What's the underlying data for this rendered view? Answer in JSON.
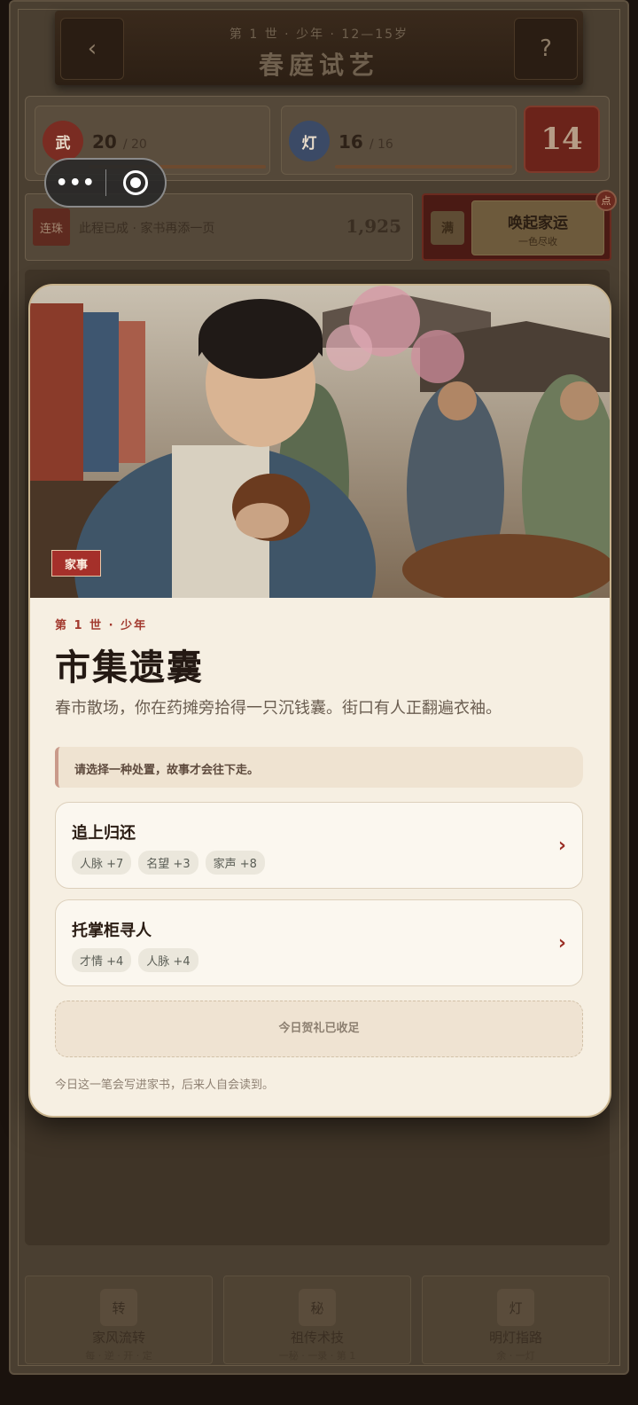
{
  "header": {
    "subtitle": "第 1 世 · 少年 · 12—15岁",
    "title": "春庭试艺",
    "back_label": "‹",
    "help_label": "?"
  },
  "stats": {
    "martial": {
      "icon_label": "武",
      "value": "20",
      "max": "/ 20",
      "fill": 1.0
    },
    "lamp": {
      "icon_label": "灯",
      "value": "16",
      "max": "/ 16",
      "fill": 1.0
    },
    "badge": "14"
  },
  "capsule": {
    "more": "•••",
    "icons": [
      "more-icon",
      "record-icon"
    ]
  },
  "streak": {
    "tag": "连珠",
    "text": "此程已成 · 家书再添一页",
    "count": "1,925"
  },
  "luck": {
    "full_label": "满",
    "title": "唤起家运",
    "subtitle": "一色尽收",
    "dot_label": "点"
  },
  "bottom_cards": [
    {
      "icon": "转",
      "title": "家风流转",
      "sub": "每 · 逆 · 开 · 定"
    },
    {
      "icon": "秘",
      "title": "祖传术技",
      "sub": "一秘 · 一录 · 第 1"
    },
    {
      "icon": "灯",
      "title": "明灯指路",
      "sub": "余 · 一灯"
    }
  ],
  "modal": {
    "image_tag": "家事",
    "era": "第 1 世 · 少年",
    "title": "市集遗囊",
    "description": "春市散场，你在药摊旁拾得一只沉钱囊。街口有人正翻遍衣袖。",
    "notice": "请选择一种处置，故事才会往下走。",
    "choices": [
      {
        "label": "追上归还",
        "effects": [
          "人脉 +7",
          "名望 +3",
          "家声 +8"
        ]
      },
      {
        "label": "托掌柜寻人",
        "effects": [
          "才情 +4",
          "人脉 +4"
        ]
      }
    ],
    "gift_status": "今日贺礼已收足",
    "footnote": "今日这一笔会写进家书，后来人自会读到。"
  }
}
